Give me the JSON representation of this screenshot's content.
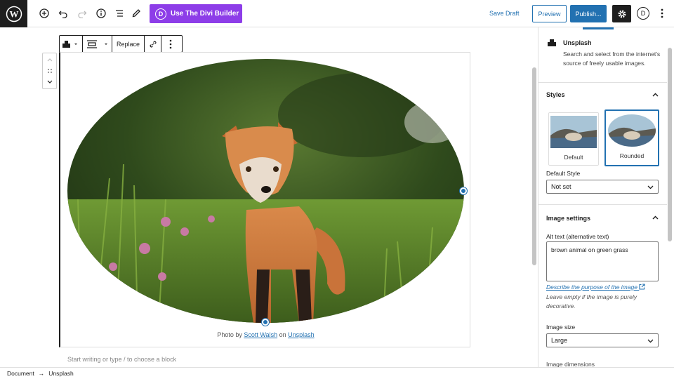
{
  "topbar": {
    "divi_button": "Use The Divi Builder",
    "save_draft": "Save Draft",
    "preview": "Preview",
    "publish": "Publish...",
    "divi_initial": "D"
  },
  "block_toolbar": {
    "replace": "Replace"
  },
  "image_block": {
    "caption_prefix": "Photo by ",
    "caption_author": "Scott Walsh",
    "caption_mid": " on ",
    "caption_source": "Unsplash",
    "placeholder": "Start writing or type / to choose a block"
  },
  "sidebar": {
    "block_name": "Unsplash",
    "block_description": "Search and select from the internet's source of freely usable images.",
    "styles": {
      "heading": "Styles",
      "options": [
        {
          "label": "Default",
          "selected": false
        },
        {
          "label": "Rounded",
          "selected": true
        }
      ],
      "default_style_label": "Default Style",
      "default_style_value": "Not set"
    },
    "image_settings": {
      "heading": "Image settings",
      "alt_label": "Alt text (alternative text)",
      "alt_value": "brown animal on green grass",
      "alt_help_link": "Describe the purpose of the image",
      "alt_help_text": "Leave empty if the image is purely decorative.",
      "size_label": "Image size",
      "size_value": "Large",
      "dimensions_label": "Image dimensions"
    }
  },
  "footer": {
    "crumb_1": "Document",
    "arrow": "→",
    "crumb_2": "Unsplash"
  },
  "colors": {
    "accent": "#2271b1",
    "divi": "#8d3de8",
    "dark": "#1e1e1e"
  },
  "icons": [
    "wordpress-logo",
    "add-block-icon",
    "undo-icon",
    "redo-icon",
    "info-icon",
    "list-view-icon",
    "tools-icon",
    "gear-icon",
    "more-icon",
    "image-block-icon",
    "align-icon",
    "link-icon",
    "chevron-up-icon",
    "chevron-down-icon",
    "drag-icon",
    "external-link-icon"
  ]
}
